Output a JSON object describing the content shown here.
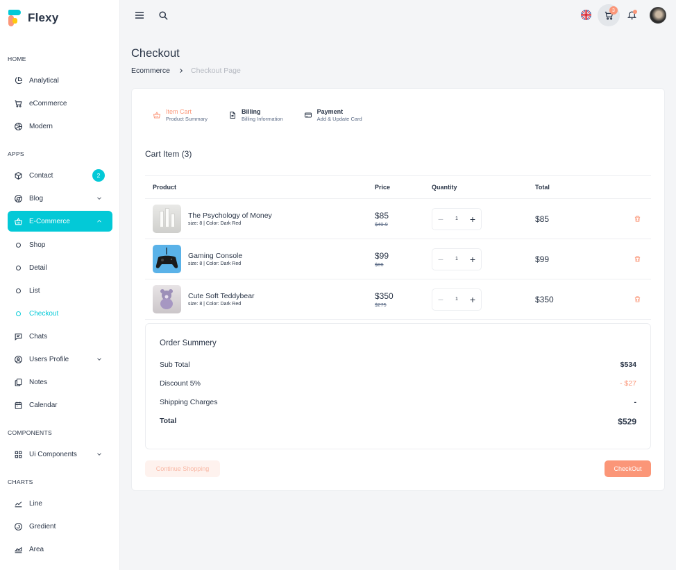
{
  "app": {
    "name": "Flexy"
  },
  "sidebar": {
    "sections": [
      {
        "label": "HOME"
      },
      {
        "label": "APPS"
      },
      {
        "label": "COMPONENTS"
      },
      {
        "label": "CHARTS"
      }
    ],
    "items": [
      {
        "label": "Analytical",
        "icon": "pie-chart-icon"
      },
      {
        "label": "eCommerce",
        "icon": "cart-icon"
      },
      {
        "label": "Modern",
        "icon": "aperture-icon"
      },
      {
        "label": "Contact",
        "icon": "box-icon",
        "badge": "2"
      },
      {
        "label": "Blog",
        "icon": "chrome-icon"
      },
      {
        "label": "E-Commerce",
        "icon": "basket-icon"
      },
      {
        "label": "Shop",
        "icon": "circle-icon"
      },
      {
        "label": "Detail",
        "icon": "circle-icon"
      },
      {
        "label": "List",
        "icon": "circle-icon"
      },
      {
        "label": "Checkout",
        "icon": "circle-icon"
      },
      {
        "label": "Chats",
        "icon": "message-icon"
      },
      {
        "label": "Users Profile",
        "icon": "user-circle-icon"
      },
      {
        "label": "Notes",
        "icon": "notes-icon"
      },
      {
        "label": "Calendar",
        "icon": "calendar-icon"
      },
      {
        "label": "Ui Components",
        "icon": "grid-icon"
      },
      {
        "label": "Line",
        "icon": "line-chart-icon"
      },
      {
        "label": "Gredient",
        "icon": "gradient-icon"
      },
      {
        "label": "Area",
        "icon": "area-chart-icon"
      }
    ]
  },
  "topbar": {
    "cart_count": "3"
  },
  "page": {
    "title": "Checkout",
    "breadcrumb": {
      "home": "Ecommerce",
      "current": "Checkout Page"
    }
  },
  "steps": [
    {
      "title": "Item Cart",
      "subtitle": "Product Summary"
    },
    {
      "title": "Billing",
      "subtitle": "Billing Information"
    },
    {
      "title": "Payment",
      "subtitle": "Add & Update Card"
    }
  ],
  "cart": {
    "heading": "Cart Item (3)",
    "columns": {
      "product": "Product",
      "price": "Price",
      "quantity": "Quantity",
      "total": "Total"
    },
    "rows": [
      {
        "name": "The Psychology of Money",
        "meta": "size: 8 | Color: Dark Red",
        "price": "$85",
        "old_price": "$49.9",
        "qty": "1",
        "total": "$85"
      },
      {
        "name": "Gaming Console",
        "meta": "size: 8 | Color: Dark Red",
        "price": "$99",
        "old_price": "$86",
        "qty": "1",
        "total": "$99"
      },
      {
        "name": "Cute Soft Teddybear",
        "meta": "size: 8 | Color: Dark Red",
        "price": "$350",
        "old_price": "$275",
        "qty": "1",
        "total": "$350"
      }
    ]
  },
  "summary": {
    "title": "Order Summery",
    "sub_total_label": "Sub Total",
    "sub_total": "$534",
    "discount_label": "Discount 5%",
    "discount": "- $27",
    "shipping_label": "Shipping Charges",
    "shipping": "-",
    "total_label": "Total",
    "total": "$529"
  },
  "actions": {
    "continue": "Continue Shopping",
    "checkout": "CheckOut"
  },
  "colors": {
    "primary": "#03c9d7",
    "secondary": "#fb9678",
    "text": "#2a3547"
  }
}
